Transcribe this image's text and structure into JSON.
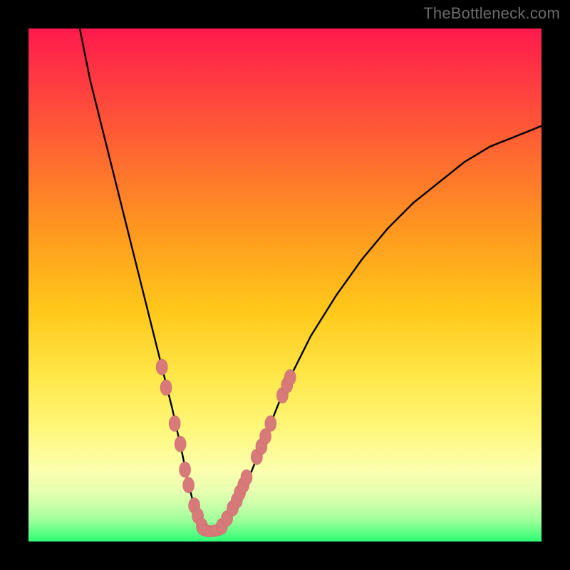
{
  "watermark": {
    "text": "TheBottleneck.com"
  },
  "colors": {
    "curve_stroke": "#000000",
    "marker_fill": "#d97a7a",
    "marker_stroke": "#c96a6a",
    "gradient_top": "#ff1a4d",
    "gradient_bottom": "#2cff75",
    "frame": "#000000"
  },
  "chart_data": {
    "type": "line",
    "title": "",
    "xlabel": "",
    "ylabel": "",
    "xlim": [
      0,
      100
    ],
    "ylim": [
      0,
      100
    ],
    "grid": false,
    "legend": false,
    "series": [
      {
        "name": "curve",
        "x": [
          10,
          12,
          15,
          18,
          20,
          22,
          24,
          26,
          28,
          30,
          31,
          32,
          33,
          34,
          35,
          36,
          38,
          40,
          42,
          44,
          46,
          50,
          55,
          60,
          65,
          70,
          75,
          80,
          85,
          90,
          95,
          100
        ],
        "values": [
          100,
          90,
          78,
          66,
          58,
          50,
          42,
          34,
          26,
          17,
          12,
          8,
          5,
          3,
          2,
          2,
          3,
          6,
          10,
          15,
          20,
          30,
          40,
          48,
          55,
          61,
          66,
          70,
          74,
          77,
          79,
          81
        ]
      }
    ],
    "markers_left": [
      {
        "x": 26.0,
        "y": 34
      },
      {
        "x": 26.8,
        "y": 30
      },
      {
        "x": 28.5,
        "y": 23
      },
      {
        "x": 29.6,
        "y": 19
      },
      {
        "x": 30.5,
        "y": 14
      },
      {
        "x": 31.2,
        "y": 11
      },
      {
        "x": 32.3,
        "y": 7
      },
      {
        "x": 33.0,
        "y": 5
      },
      {
        "x": 33.8,
        "y": 3
      }
    ],
    "markers_bottom": [
      {
        "x": 34.4,
        "y": 2.2
      },
      {
        "x": 35.1,
        "y": 2.0
      },
      {
        "x": 35.9,
        "y": 2.0
      },
      {
        "x": 36.7,
        "y": 2.2
      }
    ],
    "markers_right": [
      {
        "x": 37.7,
        "y": 3.0
      },
      {
        "x": 38.7,
        "y": 4.5
      },
      {
        "x": 39.8,
        "y": 6.5
      },
      {
        "x": 40.6,
        "y": 8.0
      },
      {
        "x": 41.2,
        "y": 9.5
      },
      {
        "x": 41.9,
        "y": 11
      },
      {
        "x": 42.5,
        "y": 12.5
      },
      {
        "x": 44.5,
        "y": 16.5
      },
      {
        "x": 45.4,
        "y": 18.5
      },
      {
        "x": 46.2,
        "y": 20.5
      },
      {
        "x": 47.2,
        "y": 23.0
      },
      {
        "x": 49.5,
        "y": 28.5
      },
      {
        "x": 50.4,
        "y": 30.5
      },
      {
        "x": 51.0,
        "y": 32
      }
    ]
  }
}
